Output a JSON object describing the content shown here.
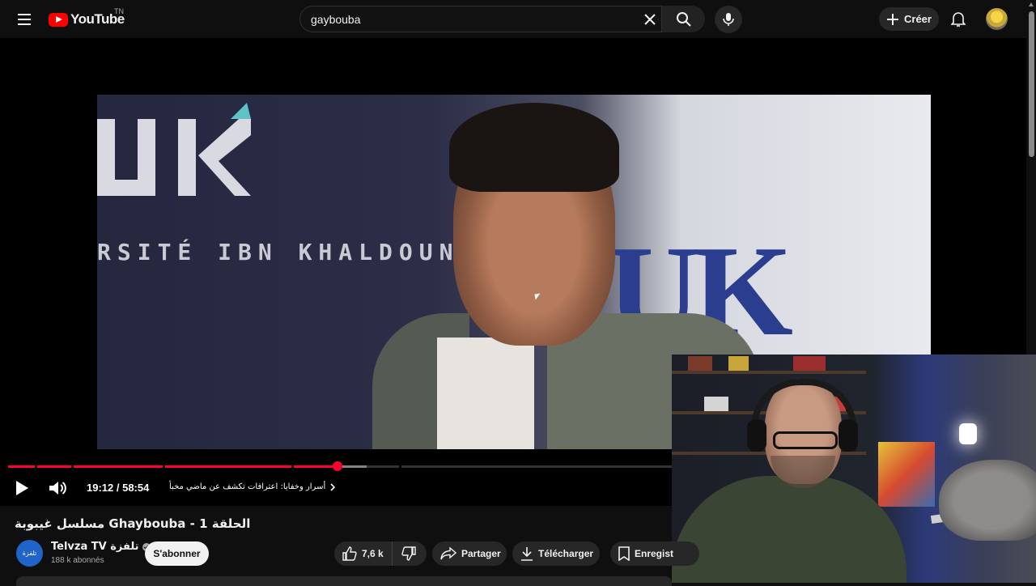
{
  "header": {
    "logo_text": "YouTube",
    "country_code": "TN",
    "search_value": "gaybouba",
    "create_label": "Créer"
  },
  "player": {
    "time": "19:12 / 58:54",
    "chapter_title": "أسرار وخفايا: اعترافات تكشف عن ماضي مخبأ",
    "progress_fraction": 0.326,
    "buffer_fraction": 0.355,
    "video_banner_text": "RSITÉ IBN KHALDOUN",
    "video_logo_right": "UK",
    "video_logo_left": "UIK"
  },
  "video": {
    "title": "الحلقة 1 - Ghaybouba مسلسل غيبوبة",
    "channel_name": "Telvza TV تلفزة",
    "channel_avatar_text": "تلفزة",
    "subscribers": "188 k abonnés",
    "subscribe_label": "S'abonner",
    "likes": "7,6 k",
    "share_label": "Partager",
    "download_label": "Télécharger",
    "save_label": "Enregist"
  },
  "colors": {
    "accent_red": "#ff0033",
    "background": "#0f0f0f",
    "pill_bg": "#272727"
  }
}
